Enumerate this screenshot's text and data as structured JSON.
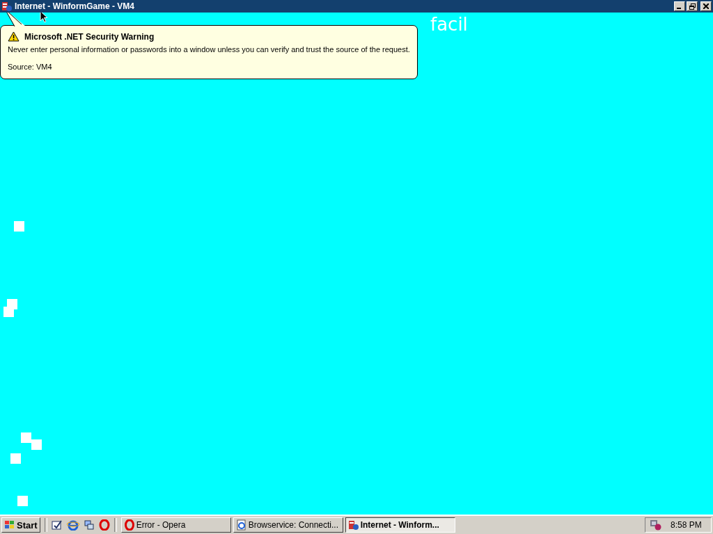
{
  "window": {
    "title": "Internet - WinformGame - VM4"
  },
  "game": {
    "caption": "facil"
  },
  "balloon": {
    "title": "Microsoft .NET Security Warning",
    "message": "Never enter personal information or passwords into a window unless you can verify and trust the source of the request.",
    "source": "Source: VM4"
  },
  "taskbar": {
    "start": "Start",
    "tasks": [
      {
        "label": "Error - Opera",
        "selected": false,
        "kind": "opera"
      },
      {
        "label": "Browservice: Connecti...",
        "selected": false,
        "kind": "ie"
      },
      {
        "label": "Internet - Winform...",
        "selected": true,
        "kind": "app"
      }
    ],
    "clock": "8:58 PM"
  }
}
